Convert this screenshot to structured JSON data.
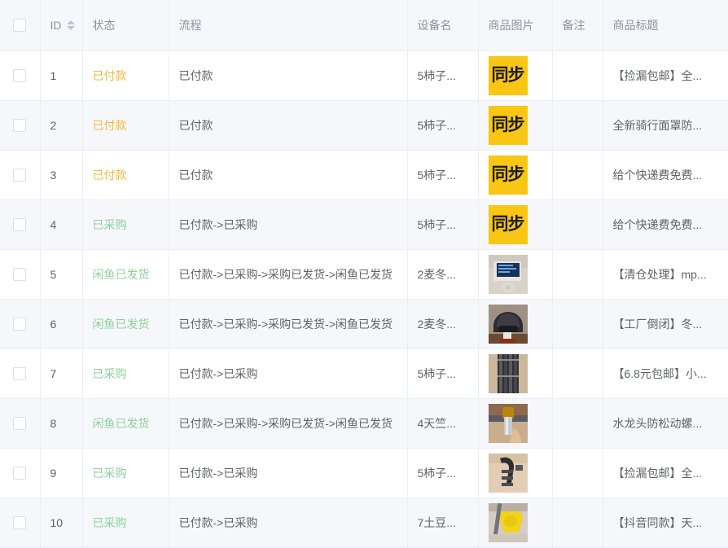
{
  "table": {
    "columns": [
      {
        "key": "select",
        "label": ""
      },
      {
        "key": "id",
        "label": "ID"
      },
      {
        "key": "status",
        "label": "状态"
      },
      {
        "key": "flow",
        "label": "流程"
      },
      {
        "key": "device",
        "label": "设备名"
      },
      {
        "key": "image",
        "label": "商品图片"
      },
      {
        "key": "note",
        "label": "备注"
      },
      {
        "key": "title",
        "label": "商品标题"
      }
    ],
    "sort_column": "ID",
    "rows": [
      {
        "id": "1",
        "status": "已付款",
        "status_kind": "paid",
        "flow": "已付款",
        "device": "5柿子...",
        "image": "同步",
        "image_kind": "sync",
        "note": "",
        "title": "【捡漏包邮】全..."
      },
      {
        "id": "2",
        "status": "已付款",
        "status_kind": "paid",
        "flow": "已付款",
        "device": "5柿子...",
        "image": "同步",
        "image_kind": "sync",
        "note": "",
        "title": "全新骑行面罩防..."
      },
      {
        "id": "3",
        "status": "已付款",
        "status_kind": "paid",
        "flow": "已付款",
        "device": "5柿子...",
        "image": "同步",
        "image_kind": "sync",
        "note": "",
        "title": "给个快递费免费..."
      },
      {
        "id": "4",
        "status": "已采购",
        "status_kind": "purchased",
        "flow": "已付款->已采购",
        "device": "5柿子...",
        "image": "同步",
        "image_kind": "sync",
        "note": "",
        "title": "给个快递费免费..."
      },
      {
        "id": "5",
        "status": "闲鱼已发货",
        "status_kind": "shipped",
        "flow": "已付款->已采购->采购已发货->闲鱼已发货",
        "device": "2麦冬...",
        "image": "mp3-player-photo",
        "image_kind": "photo-mp3",
        "note": "",
        "title": "【清仓处理】mp..."
      },
      {
        "id": "6",
        "status": "闲鱼已发货",
        "status_kind": "shipped",
        "flow": "已付款->已采购->采购已发货->闲鱼已发货",
        "device": "2麦冬...",
        "image": "helmet-photo",
        "image_kind": "photo-helmet",
        "note": "",
        "title": "【工厂倒闭】冬..."
      },
      {
        "id": "7",
        "status": "已采购",
        "status_kind": "purchased",
        "flow": "已付款->已采购",
        "device": "5柿子...",
        "image": "screwdriver-bits-photo",
        "image_kind": "photo-bits",
        "note": "",
        "title": "【6.8元包邮】小..."
      },
      {
        "id": "8",
        "status": "闲鱼已发货",
        "status_kind": "shipped",
        "flow": "已付款->已采购->采购已发货->闲鱼已发货",
        "device": "4天竺...",
        "image": "faucet-photo",
        "image_kind": "photo-faucet",
        "note": "",
        "title": "水龙头防松动螺..."
      },
      {
        "id": "9",
        "status": "已采购",
        "status_kind": "purchased",
        "flow": "已付款->已采购",
        "device": "5柿子...",
        "image": "hand-gripper-photo",
        "image_kind": "photo-gripper",
        "note": "",
        "title": "【捡漏包邮】全..."
      },
      {
        "id": "10",
        "status": "已采购",
        "status_kind": "purchased",
        "flow": "已付款->已采购",
        "device": "7土豆...",
        "image": "yellow-tool-photo",
        "image_kind": "photo-yellow",
        "note": "",
        "title": "【抖音同款】天..."
      }
    ]
  },
  "colors": {
    "header_bg": "#f5f7fa",
    "border": "#ebeef5",
    "text": "#606266",
    "header_text": "#909399",
    "status_paid": "#f2ba3c",
    "status_purchased": "#8dd09a",
    "status_shipped": "#8dd09a",
    "sync_badge_bg": "#f8c613"
  }
}
